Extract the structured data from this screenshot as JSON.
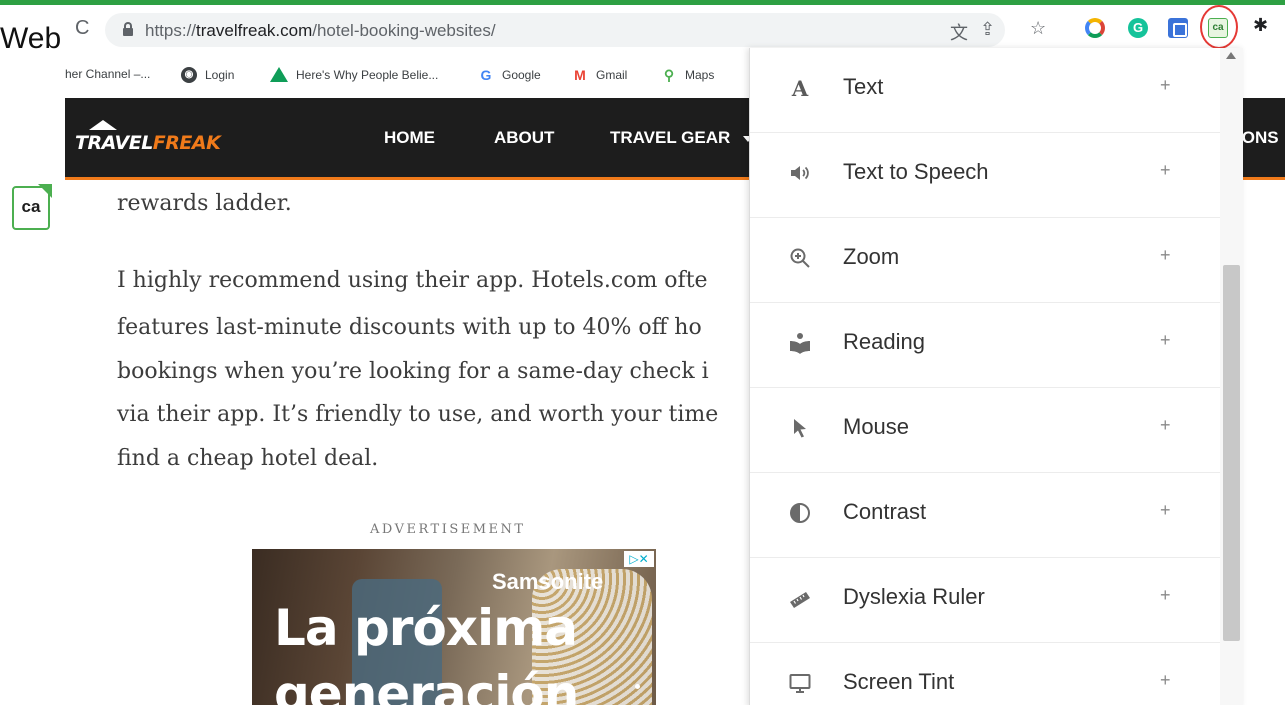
{
  "slide": {
    "title_fragment": "Web"
  },
  "browser": {
    "url_prefix": "https://",
    "url_host": "travelfreak.com",
    "url_path": "/hotel-booking-websites/",
    "extensions": [
      {
        "name": "color-ring-extension"
      },
      {
        "name": "grammarly",
        "letter": "G"
      },
      {
        "name": "blue-square-extension"
      },
      {
        "name": "ca-accessibility-extension",
        "letter": "ca",
        "highlighted": true
      },
      {
        "name": "extensions-puzzle"
      }
    ],
    "bookmarks": [
      {
        "label": "her Channel –...",
        "icon": "partial"
      },
      {
        "label": "Login",
        "icon": "globe-icon"
      },
      {
        "label": "Here's Why People Belie...",
        "icon": "drive-icon"
      },
      {
        "label": "Google",
        "icon": "google-icon"
      },
      {
        "label": "Gmail",
        "icon": "gmail-icon"
      },
      {
        "label": "Maps",
        "icon": "maps-icon"
      }
    ]
  },
  "site": {
    "logo_main": "TRAVEL",
    "logo_accent": "FREAK",
    "nav": [
      "HOME",
      "ABOUT",
      "TRAVEL GEAR"
    ],
    "nav_partial": "IONS",
    "accent_color": "#f07a1a"
  },
  "side_badge": {
    "text": "ca"
  },
  "article": {
    "line0": "rewards ladder.",
    "lines": [
      "I highly recommend using their app. Hotels.com ofte",
      "features last-minute discounts with up to 40% off ho",
      "bookings when you’re looking for a same-day check i",
      "via their app. It’s friendly to use, and worth your time",
      "find a cheap hotel deal."
    ],
    "ad_label": "ADVERTISEMENT"
  },
  "ad": {
    "brand": "Samsonite",
    "headline_1": "La próxima",
    "headline_2": "generación",
    "choices": "▷✕"
  },
  "panel": {
    "items": [
      {
        "label": "Text",
        "icon": "text-icon",
        "glyph": "A"
      },
      {
        "label": "Text to Speech",
        "icon": "speaker-icon",
        "glyph": "🔈"
      },
      {
        "label": "Zoom",
        "icon": "zoom-icon",
        "glyph": "⊕"
      },
      {
        "label": "Reading",
        "icon": "reading-icon",
        "glyph": ""
      },
      {
        "label": "Mouse",
        "icon": "mouse-pointer-icon",
        "glyph": ""
      },
      {
        "label": "Contrast",
        "icon": "contrast-icon",
        "glyph": "◐"
      },
      {
        "label": "Dyslexia Ruler",
        "icon": "ruler-icon",
        "glyph": ""
      },
      {
        "label": "Screen Tint",
        "icon": "monitor-icon",
        "glyph": ""
      }
    ],
    "expand_symbol": "+"
  }
}
